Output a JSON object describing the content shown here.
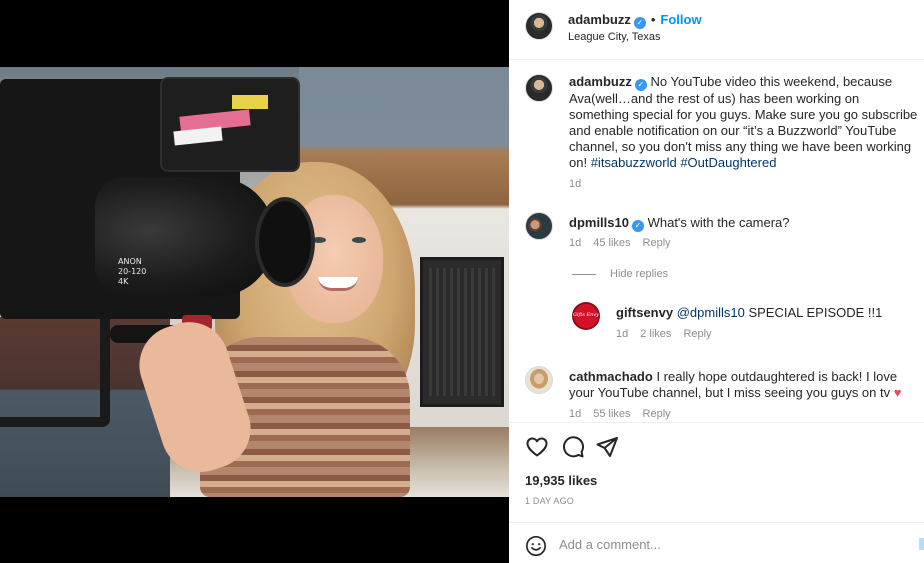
{
  "post": {
    "author": "adambuzz",
    "location": "League City, Texas",
    "follow_label": "Follow",
    "dot": "•",
    "verified_glyph": "✓"
  },
  "caption": {
    "author": "adambuzz",
    "text": "No YouTube video this weekend, because Ava(well…and the rest of us) has been working on something special for you guys. Make sure you go subscribe and enable notification on our “it’s a Buzzworld” YouTube channel, so you don't miss any thing we have been working on!",
    "tag1": "#itsabuzzworld",
    "tag2": "#OutDaughtered",
    "time": "1d"
  },
  "comments": [
    {
      "author": "dpmills10",
      "text": "What's with the camera?",
      "time": "1d",
      "likes": "45 likes",
      "reply_label": "Reply"
    },
    {
      "author": "giftsenvy",
      "mention": "@dpmills10",
      "text": "SPECIAL EPISODE !!1",
      "time": "1d",
      "likes": "2 likes",
      "reply_label": "Reply",
      "avatar_text": "Gifts Envy"
    },
    {
      "author": "cathmachado",
      "text": "I really hope outdaughtered is back! I love your YouTube channel, but I miss seeing you guys on tv",
      "heart": "♥",
      "time": "1d",
      "likes": "55 likes",
      "reply_label": "Reply"
    }
  ],
  "hide_replies_label": "Hide replies",
  "photo": {
    "lens_text": "ANON\n20-120\n4K"
  },
  "actions": {
    "like_icon": "heart-icon",
    "comment_icon": "comment-icon",
    "share_icon": "share-icon"
  },
  "likes_count": "19,935 likes",
  "timestamp": "1 DAY AGO",
  "add_comment": {
    "placeholder": "Add a comment...",
    "emoji_icon": "smiley-icon"
  },
  "colors": {
    "accent": "#0095f6",
    "verified": "#3897f0",
    "link": "#00376b",
    "muted": "#8e8e8e",
    "heart": "#ed4956"
  }
}
